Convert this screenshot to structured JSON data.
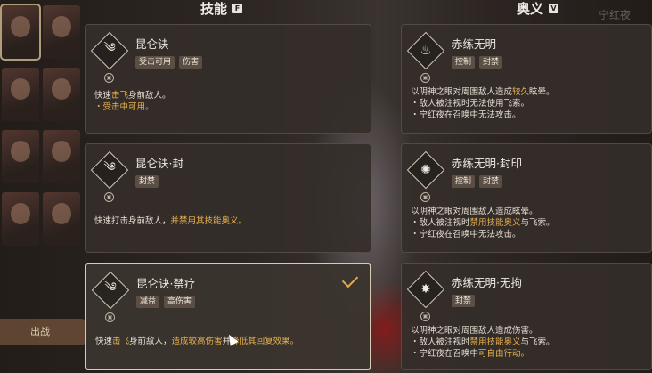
{
  "headers": {
    "skills": {
      "label": "技能",
      "key": "F"
    },
    "ultimate": {
      "label": "奥义",
      "key": "V"
    }
  },
  "corner_text": "宁红夜",
  "left_panel": {
    "bottom_button": "出战"
  },
  "skills": [
    {
      "title": "昆仑诀",
      "tags": [
        "受击可用",
        "伤害"
      ],
      "desc_lines": [
        [
          {
            "t": "快速"
          },
          {
            "t": "击飞",
            "hl": true
          },
          {
            "t": "身前敌人。"
          }
        ],
        [
          {
            "t": "・受击中可用。",
            "hl": true
          }
        ]
      ]
    },
    {
      "title": "昆仑诀·封",
      "tags": [
        "封禁"
      ],
      "desc_lines": [
        [
          {
            "t": "快速打击身前敌人，"
          },
          {
            "t": "并禁用其技能奥义。",
            "hl": true
          }
        ]
      ]
    },
    {
      "title": "昆仑诀·禁疗",
      "tags": [
        "减益",
        "高伤害"
      ],
      "selected": true,
      "desc_lines": [
        [
          {
            "t": "快速"
          },
          {
            "t": "击飞",
            "hl": true
          },
          {
            "t": "身前敌人，"
          },
          {
            "t": "造成较高伤害",
            "hl": true
          },
          {
            "t": "并"
          },
          {
            "t": "降低其回复效果。",
            "hl": true
          }
        ]
      ]
    }
  ],
  "ultimates": [
    {
      "title": "赤练无明",
      "tags": [
        "控制",
        "封禁"
      ],
      "desc_lines": [
        [
          {
            "t": "以阴神之眼对周围敌人造成"
          },
          {
            "t": "较久",
            "hl": true
          },
          {
            "t": "眩晕。"
          }
        ],
        [
          {
            "t": "・敌人被注视时无法使用飞索。"
          }
        ],
        [
          {
            "t": "・宁红夜在召唤中无法攻击。"
          }
        ]
      ]
    },
    {
      "title": "赤练无明·封印",
      "tags": [
        "控制",
        "封禁"
      ],
      "desc_lines": [
        [
          {
            "t": "以阴神之眼对周围敌人造成眩晕。"
          }
        ],
        [
          {
            "t": "・敌人被注视时"
          },
          {
            "t": "禁用技能奥义",
            "hl": true
          },
          {
            "t": "与飞索。"
          }
        ],
        [
          {
            "t": "・宁红夜在召唤中无法攻击。"
          }
        ]
      ]
    },
    {
      "title": "赤练无明·无拘",
      "tags": [
        "封禁"
      ],
      "desc_lines": [
        [
          {
            "t": "以阴神之眼对周围敌人造成伤害。"
          }
        ],
        [
          {
            "t": "・敌人被注视时"
          },
          {
            "t": "禁用技能奥义",
            "hl": true
          },
          {
            "t": "与飞索。"
          }
        ],
        [
          {
            "t": "・宁红夜在召唤中"
          },
          {
            "t": "可自由行动。",
            "hl": true
          }
        ]
      ]
    }
  ],
  "icons": {
    "skill_emblem": "swirl-blade-icon",
    "ult_emblems": [
      "flame-icon",
      "seal-icon",
      "burst-icon"
    ],
    "selected_check": "checkmark-icon"
  },
  "colors": {
    "highlight": "#e9b24f",
    "check": "#e8a64a"
  }
}
